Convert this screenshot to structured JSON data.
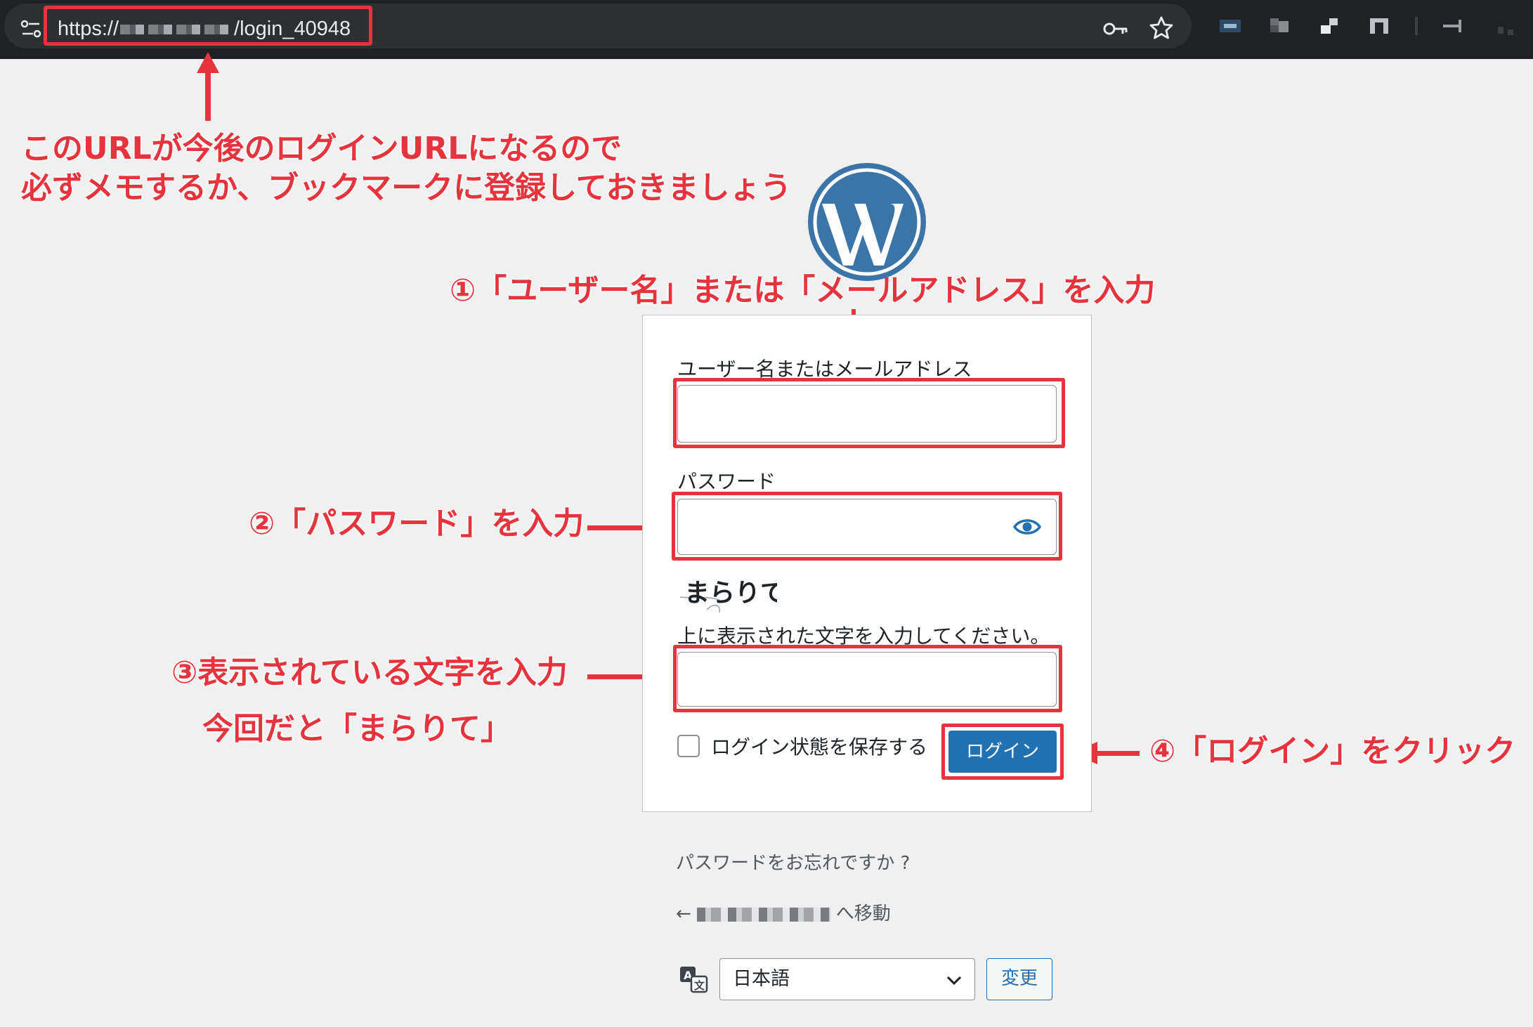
{
  "browser": {
    "url_prefix": "https://",
    "url_suffix": "/login_40948"
  },
  "annotations": {
    "url_note_line1": "このURLが今後のログインURLになるので",
    "url_note_line2": "必ずメモするか、ブックマークに登録しておきましょう",
    "step1": "①「ユーザー名」または「メールアドレス」を入力",
    "step2": "②「パスワード」を入力",
    "step3_line1": "③表示されている文字を入力",
    "step3_line2": "今回だと「まらりて」",
    "step4": "④「ログイン」をクリック"
  },
  "login_form": {
    "username_label": "ユーザー名またはメールアドレス",
    "username_value": "",
    "password_label": "パスワード",
    "password_value": "",
    "captcha_text": "まらりて",
    "captcha_instruction": "上に表示された文字を入力してください。",
    "captcha_value": "",
    "remember_label": "ログイン状態を保存する",
    "remember_checked": false,
    "login_button": "ログイン"
  },
  "footer": {
    "lost_password": "パスワードをお忘れですか ?",
    "back_arrow": "←",
    "back_suffix": "へ移動",
    "language_selected": "日本語",
    "change_button": "変更"
  },
  "colors": {
    "annotation_red": "#e5343d",
    "wp_blue": "#2271b1",
    "wp_logo_blue": "#3b75a8",
    "page_bg": "#f0f0f1"
  }
}
